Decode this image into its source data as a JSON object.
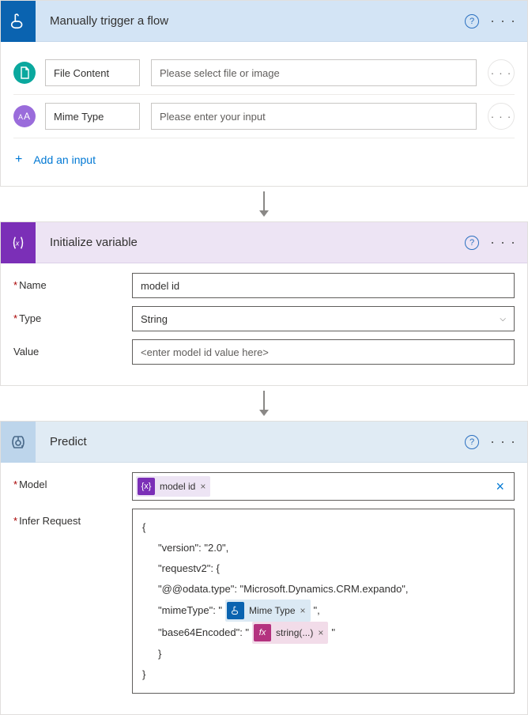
{
  "trigger": {
    "title": "Manually trigger a flow",
    "inputs": [
      {
        "label": "File Content",
        "placeholder": "Please select file or image",
        "icon": "file"
      },
      {
        "label": "Mime Type",
        "placeholder": "Please enter your input",
        "icon": "text"
      }
    ],
    "add_label": "Add an input"
  },
  "initvar": {
    "title": "Initialize variable",
    "name_label": "Name",
    "name_value": "model id",
    "type_label": "Type",
    "type_value": "String",
    "value_label": "Value",
    "value_placeholder": "<enter model id value here>"
  },
  "predict": {
    "title": "Predict",
    "model_label": "Model",
    "model_token": "model id",
    "infer_label": "Infer Request",
    "json": {
      "open": "{",
      "version": "\"version\": \"2.0\",",
      "req": "\"requestv2\": {",
      "odata": "\"@@odata.type\": \"Microsoft.Dynamics.CRM.expando\",",
      "mime_key": "\"mimeType\": \"",
      "mime_token": "Mime Type",
      "mime_close": "\",",
      "b64_key": "\"base64Encoded\": \"",
      "b64_token": "string(...)",
      "b64_close": "\"",
      "close1": "}",
      "close2": "}"
    }
  }
}
